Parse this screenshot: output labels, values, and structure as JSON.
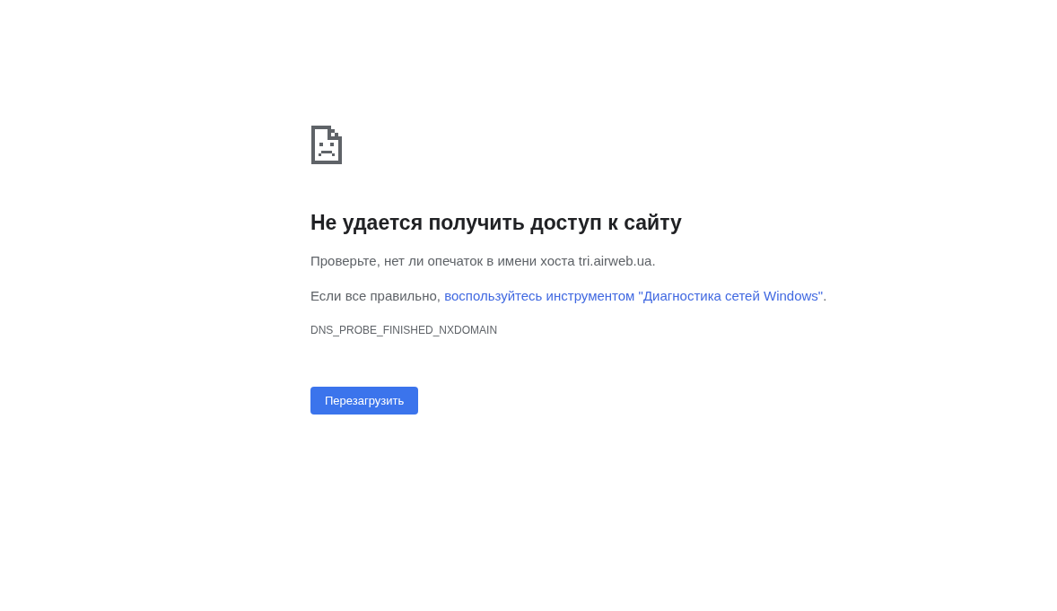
{
  "heading": "Не удается получить доступ к сайту",
  "suggestion": "Проверьте, нет ли опечаток в имени хоста tri.airweb.ua.",
  "diagnostics": {
    "before": "Если все правильно,",
    "link": "воспользуйтесь инструментом \"Диагностика сетей Windows\"",
    "after": "."
  },
  "error_code": "DNS_PROBE_FINISHED_NXDOMAIN",
  "button": "Перезагрузить"
}
